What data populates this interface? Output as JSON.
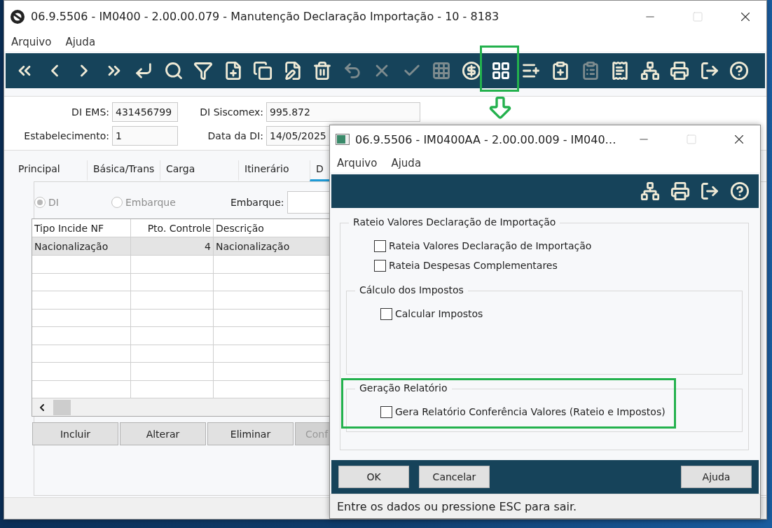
{
  "main_window": {
    "title": "06.9.5506 - IM0400 - 2.00.00.079 - Manutenção Declaração Importação - 10 - 8183",
    "menu": [
      "Arquivo",
      "Ajuda"
    ],
    "toolbar": [
      {
        "kind": "first",
        "disabled": false,
        "highlighted": false
      },
      {
        "kind": "prev",
        "disabled": false,
        "highlighted": false
      },
      {
        "kind": "next",
        "disabled": false,
        "highlighted": false
      },
      {
        "kind": "last",
        "disabled": false,
        "highlighted": false
      },
      {
        "kind": "goto",
        "disabled": false,
        "highlighted": false
      },
      {
        "kind": "search",
        "disabled": false,
        "highlighted": false
      },
      {
        "kind": "filter",
        "disabled": false,
        "highlighted": false
      },
      {
        "kind": "new",
        "disabled": false,
        "highlighted": false
      },
      {
        "kind": "copy",
        "disabled": false,
        "highlighted": false
      },
      {
        "kind": "edit",
        "disabled": false,
        "highlighted": false
      },
      {
        "kind": "delete",
        "disabled": false,
        "highlighted": false
      },
      {
        "kind": "undo",
        "disabled": true,
        "highlighted": false
      },
      {
        "kind": "cancel",
        "disabled": true,
        "highlighted": false
      },
      {
        "kind": "save",
        "disabled": true,
        "highlighted": false
      },
      {
        "kind": "table",
        "disabled": true,
        "highlighted": false
      },
      {
        "kind": "price",
        "disabled": false,
        "highlighted": false
      },
      {
        "kind": "apps",
        "disabled": false,
        "highlighted": true
      },
      {
        "kind": "list-info",
        "disabled": false,
        "highlighted": false
      },
      {
        "kind": "clipboard-add",
        "disabled": false,
        "highlighted": false
      },
      {
        "kind": "clipboard",
        "disabled": true,
        "highlighted": false
      },
      {
        "kind": "invoice",
        "disabled": false,
        "highlighted": false
      },
      {
        "kind": "tree",
        "disabled": false,
        "highlighted": false
      },
      {
        "kind": "print",
        "disabled": false,
        "highlighted": false
      },
      {
        "kind": "exit",
        "disabled": false,
        "highlighted": false
      },
      {
        "kind": "help",
        "disabled": false,
        "highlighted": false
      }
    ],
    "header_fields": [
      {
        "label": "DI EMS:",
        "value": "431456799"
      },
      {
        "label": "DI Siscomex:",
        "value": "995.872"
      },
      {
        "label": "Estabelecimento:",
        "value": "1"
      },
      {
        "label": "Data da DI:",
        "value": "14/05/2025"
      }
    ],
    "tabs": [
      {
        "label": "Principal",
        "selected": false
      },
      {
        "label": "Básica/Trans",
        "selected": false
      },
      {
        "label": "Carga",
        "selected": false
      },
      {
        "label": "Itinerário",
        "selected": false
      },
      {
        "label": "D",
        "selected": true
      }
    ],
    "source_options": [
      {
        "label": "DI",
        "selected": true,
        "disabled": true
      },
      {
        "label": "Embarque",
        "selected": false,
        "disabled": true
      }
    ],
    "embarque_field": {
      "label": "Embarque:"
    },
    "table": {
      "columns": [
        "Tipo Incide NF",
        "Pto. Controle",
        "Descrição"
      ],
      "rows": [
        {
          "cells": [
            "Nacionalização",
            "4",
            "Nacionalização"
          ],
          "selected": true
        }
      ]
    },
    "buttons": [
      {
        "label": "Incluir",
        "disabled": false
      },
      {
        "label": "Alterar",
        "disabled": false
      },
      {
        "label": "Eliminar",
        "disabled": false
      },
      {
        "label": "Conf",
        "disabled": true
      }
    ]
  },
  "dialog": {
    "title": "06.9.5506 - IM0400AA - 2.00.00.009 - IM040…",
    "menu": [
      "Arquivo",
      "Ajuda"
    ],
    "toolbar": [
      {
        "kind": "tree"
      },
      {
        "kind": "print"
      },
      {
        "kind": "exit"
      },
      {
        "kind": "help"
      }
    ],
    "group": {
      "title": "Rateio Valores Declaração de Importação",
      "options": [
        {
          "label": "Rateia Valores Declaração de Importação",
          "checked": false
        },
        {
          "label": "Rateia Despesas Complementares",
          "checked": false
        }
      ],
      "subgroups": [
        {
          "title": "Cálculo dos Impostos",
          "highlighted": false,
          "options": [
            {
              "label": "Calcular Impostos",
              "checked": false
            }
          ]
        },
        {
          "title": "Geração Relatório",
          "highlighted": true,
          "options": [
            {
              "label": "Gera Relatório Conferência Valores (Rateio e Impostos)",
              "checked": false
            }
          ]
        }
      ]
    },
    "buttons": [
      {
        "label": "OK"
      },
      {
        "label": "Cancelar"
      },
      {
        "label": "Ajuda"
      }
    ],
    "status": "Entre os dados ou pressione ESC para sair."
  }
}
